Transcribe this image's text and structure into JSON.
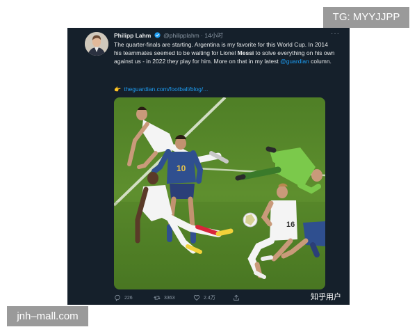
{
  "watermark_top": "TG: MYYJJPP",
  "watermark_bottom": "jnh–mall.com",
  "tweet": {
    "author_name": "Philipp Lahm",
    "handle": "@philipplahm",
    "time_separator": "·",
    "time": "14小时",
    "more_label": "···",
    "text": {
      "part1": "The quarter-finals are starting. Argentina is my favorite for this World Cup. In 2014 his teammates seemed to be waiting for Lionel ",
      "bold": "Messi",
      "part2": " to solve everything on his own against us - in 2022 they play for him. More on that in my latest ",
      "mention": "@guardian",
      "part3": " column."
    },
    "link_emoji": "👉",
    "link": "theguardian.com/football/blog/...",
    "stats": {
      "replies": "226",
      "retweets": "3363",
      "likes": "2.4万"
    },
    "corner_tag": "知乎用户"
  },
  "icons": {
    "verified": "verified-badge-icon",
    "reply": "reply-icon",
    "retweet": "retweet-icon",
    "like": "heart-icon",
    "share": "share-icon"
  },
  "colors": {
    "background": "#15202b",
    "text": "#e7e9ea",
    "muted": "#8b98a5",
    "accent": "#1d9bf0",
    "pitch": "#5e8f2e"
  }
}
